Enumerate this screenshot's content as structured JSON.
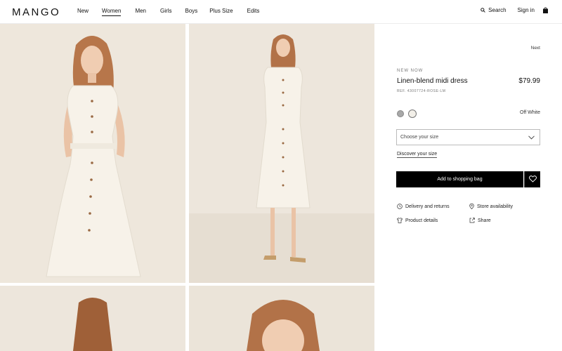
{
  "header": {
    "logo": "MANGO",
    "nav": [
      {
        "label": "New"
      },
      {
        "label": "Women"
      },
      {
        "label": "Men"
      },
      {
        "label": "Girls"
      },
      {
        "label": "Boys"
      },
      {
        "label": "Plus Size"
      },
      {
        "label": "Edits"
      }
    ],
    "active_nav": "Women",
    "search_label": "Search",
    "signin_label": "Sign in",
    "bag_icon": "shopping-bag-icon"
  },
  "gallery": {
    "images": [
      "product-photo-front",
      "product-photo-full",
      "product-photo-back",
      "product-photo-closeup"
    ]
  },
  "product": {
    "next_label": "Next",
    "tag": "NEW NOW",
    "title": "Linen-blend midi dress",
    "price": "$79.99",
    "ref": "REF. 43007724-ROSE-LM",
    "color_name": "Off White",
    "swatch_colors": [
      "#a8a8a8",
      "#f2efe8"
    ],
    "size_placeholder": "Choose your size",
    "discover_size": "Discover your size",
    "add_to_bag": "Add to shopping bag",
    "links": {
      "delivery": "Delivery and returns",
      "store": "Store availability",
      "details": "Product details",
      "share": "Share"
    }
  }
}
